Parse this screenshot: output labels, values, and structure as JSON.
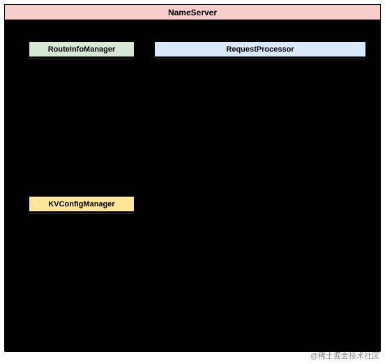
{
  "outer": {
    "title": "NameServer"
  },
  "boxes": {
    "route": {
      "title": "RouteInfoManager"
    },
    "kv": {
      "title": "KVConfigManager"
    },
    "req": {
      "title": "RequestProcessor"
    }
  },
  "watermark": "@稀土掘金技术社区"
}
